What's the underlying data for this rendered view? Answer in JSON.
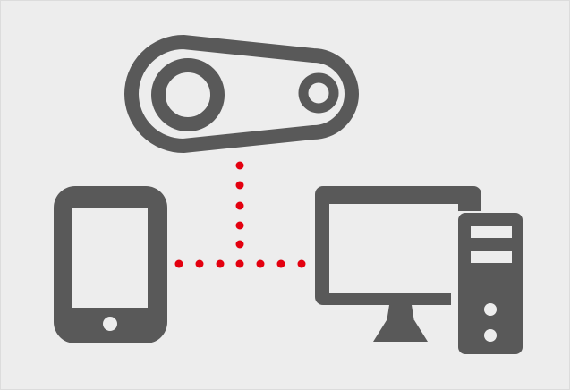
{
  "colors": {
    "background": "#ededed",
    "border": "#dcdcdc",
    "device": "#595959",
    "device_inner": "#ededed",
    "connector": "#e3000f"
  },
  "icons": {
    "belt_drive": "belt-drive-icon",
    "smartphone": "smartphone-icon",
    "desktop_computer": "desktop-computer-icon"
  }
}
